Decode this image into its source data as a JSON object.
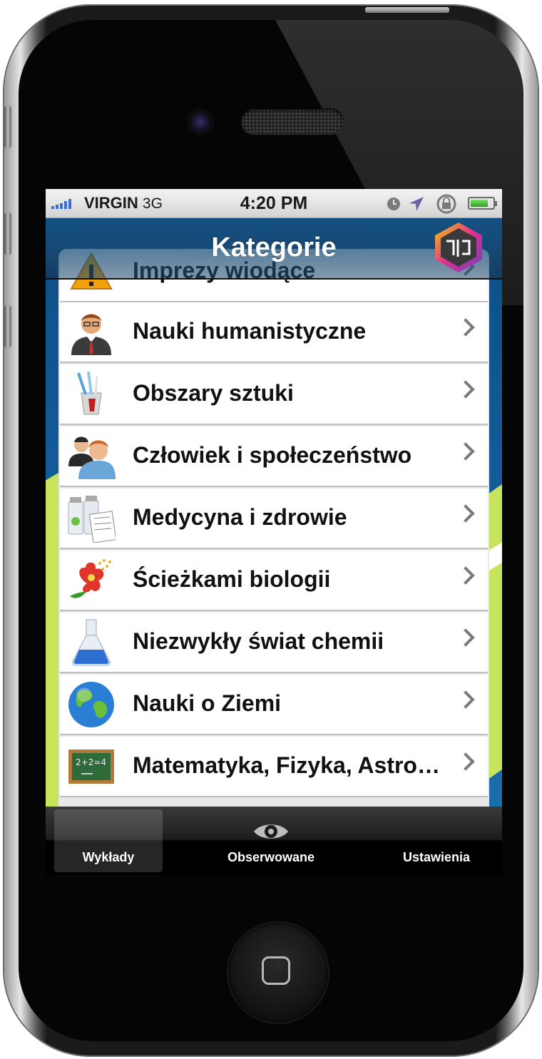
{
  "status_bar": {
    "carrier": "VIRGIN",
    "network": "3G",
    "time": "4:20 PM"
  },
  "nav": {
    "title": "Kategorie"
  },
  "categories": [
    {
      "label": "Imprezy wiodące",
      "icon": "warning-icon"
    },
    {
      "label": "Nauki humanistyczne",
      "icon": "person-tie-icon"
    },
    {
      "label": "Obszary sztuki",
      "icon": "paint-brush-cup-icon"
    },
    {
      "label": "Człowiek i społeczeństwo",
      "icon": "people-icon"
    },
    {
      "label": "Medycyna i zdrowie",
      "icon": "medicine-bottles-icon"
    },
    {
      "label": "Ścieżkami biologii",
      "icon": "flower-icon"
    },
    {
      "label": "Niezwykły świat chemii",
      "icon": "flask-icon"
    },
    {
      "label": "Nauki o Ziemi",
      "icon": "globe-icon"
    },
    {
      "label": "Matematyka, Fizyka, Astronomia",
      "icon": "chalkboard-icon"
    }
  ],
  "tabs": {
    "lectures": "Wykłady",
    "observed": "Obserwowane",
    "settings": "Ustawienia"
  },
  "colors": {
    "nav_blue": "#0e4d87",
    "accent_green": "#c7e45a",
    "tab_bar": "#000000"
  }
}
